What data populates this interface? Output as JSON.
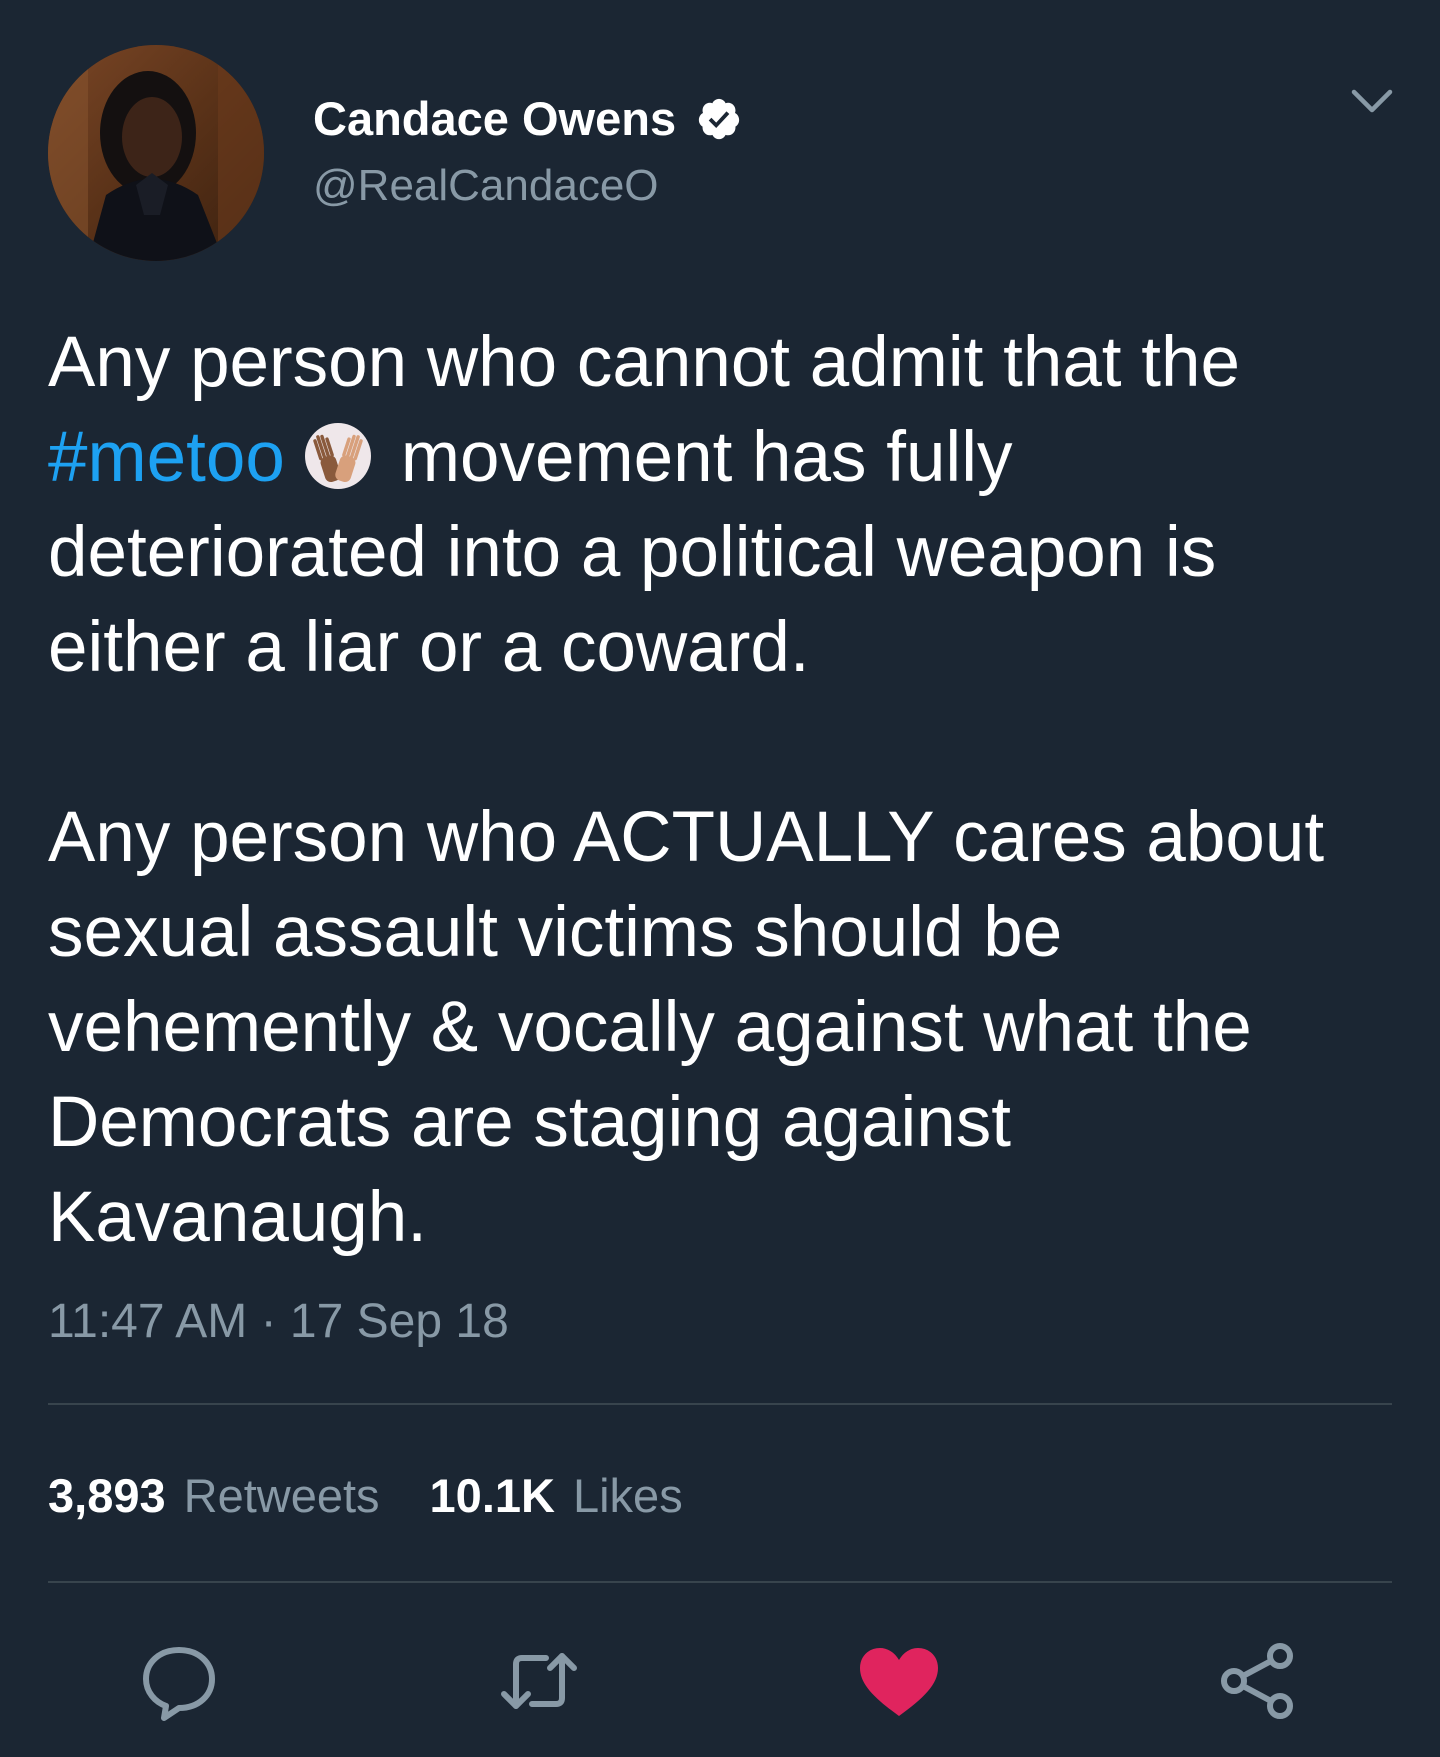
{
  "author": {
    "name": "Candace Owens",
    "handle": "@RealCandaceO"
  },
  "tweet": {
    "para1_part1": "Any person who cannot admit that the",
    "hashtag": "#metoo",
    "emoji": "raised-hands-emoji",
    "para1_part2": "movement has fully deteriorated into a political weapon is either a liar or a coward.",
    "para2": "Any person who ACTUALLY cares about sexual assault victims should be vehemently & vocally against what the Democrats are staging against Kavanaugh."
  },
  "timestamp": "11:47 AM · 17 Sep 18",
  "stats": {
    "retweets_count": "3,893",
    "retweets_label": "Retweets",
    "likes_count": "10.1K",
    "likes_label": "Likes"
  },
  "actions": [
    "reply-icon",
    "retweet-icon",
    "like-icon",
    "share-icon"
  ],
  "colors": {
    "background": "#1b2633",
    "text": "#ffffff",
    "secondary": "#8899a6",
    "link": "#1da1f2",
    "like": "#e0245e",
    "divider": "#38444d"
  }
}
